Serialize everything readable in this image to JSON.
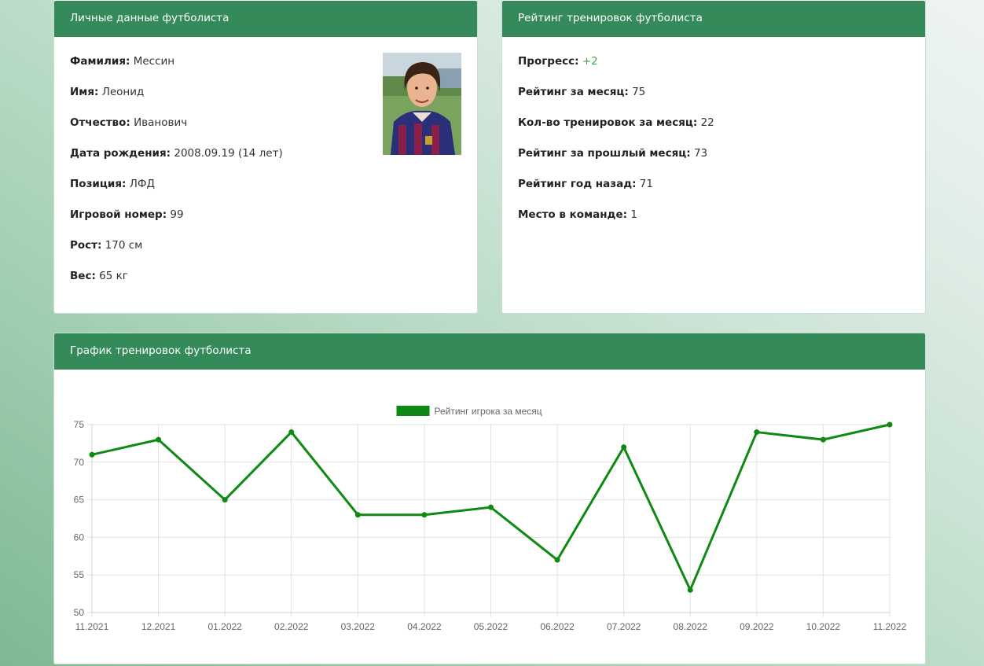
{
  "personal": {
    "header": "Личные данные футболиста",
    "rows": [
      {
        "label": "Фамилия:",
        "value": "Мессин"
      },
      {
        "label": "Имя:",
        "value": "Леонид"
      },
      {
        "label": "Отчество:",
        "value": "Иванович"
      },
      {
        "label": "Дата рождения:",
        "value": "2008.09.19 (14 лет)"
      },
      {
        "label": "Позиция:",
        "value": "ЛФД"
      },
      {
        "label": "Игровой номер:",
        "value": "99"
      },
      {
        "label": "Рост:",
        "value": "170 см"
      },
      {
        "label": "Вес:",
        "value": "65 кг"
      }
    ]
  },
  "rating": {
    "header": "Рейтинг тренировок футболиста",
    "rows": [
      {
        "label": "Прогресс:",
        "value": "+2",
        "value_color": "#3aa64a"
      },
      {
        "label": "Рейтинг за месяц:",
        "value": "75"
      },
      {
        "label": "Кол-во тренировок за месяц:",
        "value": "22"
      },
      {
        "label": "Рейтинг за прошлый месяц:",
        "value": "73"
      },
      {
        "label": "Рейтинг год назад:",
        "value": "71"
      },
      {
        "label": "Место в команде:",
        "value": "1"
      }
    ]
  },
  "chart_card": {
    "header": "График тренировок футболиста"
  },
  "colors": {
    "header_bg": "#358a59",
    "series": "#0e8a14"
  },
  "chart_data": {
    "type": "line",
    "categories": [
      "11.2021",
      "12.2021",
      "01.2022",
      "02.2022",
      "03.2022",
      "04.2022",
      "05.2022",
      "06.2022",
      "07.2022",
      "08.2022",
      "09.2022",
      "10.2022",
      "11.2022"
    ],
    "series": [
      {
        "name": "Рейтинг игрока за месяц",
        "values": [
          71,
          73,
          65,
          74,
          63,
          63,
          64,
          57,
          72,
          53,
          74,
          73,
          75
        ]
      }
    ],
    "ylim": [
      50,
      75
    ],
    "yticks": [
      50,
      55,
      60,
      65,
      70,
      75
    ],
    "grid": true,
    "legend": "top-center"
  }
}
